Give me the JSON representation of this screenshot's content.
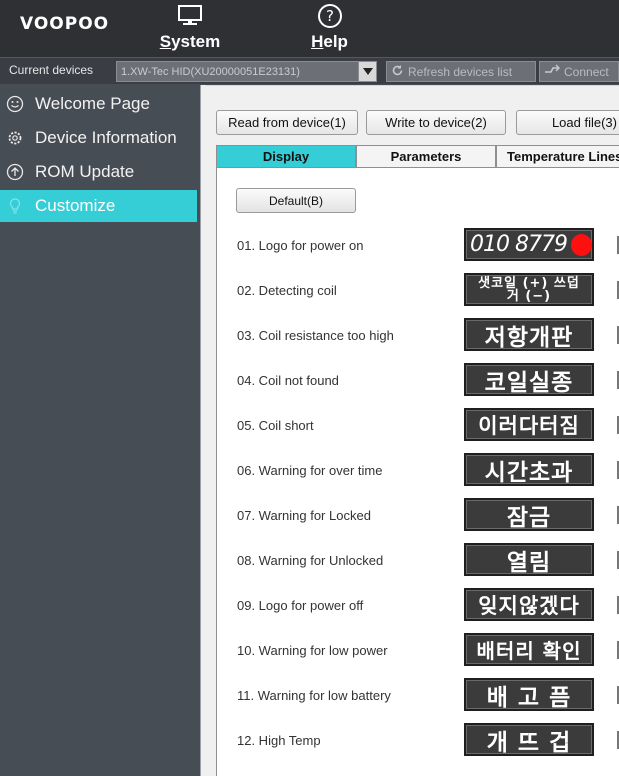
{
  "header": {
    "logo": "VOOPOO",
    "menu": [
      {
        "label": "System",
        "icon": "monitor-icon"
      },
      {
        "label": "Help",
        "icon": "question-circle-icon"
      }
    ]
  },
  "device_bar": {
    "label": "Current devices",
    "selected_device": "1.XW-Tec HID(XU20000051E23131)",
    "refresh_label": "Refresh devices list",
    "connect_label": "Connect"
  },
  "sidebar": {
    "items": [
      {
        "label": "Welcome Page",
        "icon": "smiley-icon",
        "active": false
      },
      {
        "label": "Device Information",
        "icon": "gear-icon",
        "active": false
      },
      {
        "label": "ROM Update",
        "icon": "upload-icon",
        "active": false
      },
      {
        "label": "Customize",
        "icon": "lightbulb-icon",
        "active": true
      }
    ]
  },
  "toolbar": {
    "read_label": "Read from device(1)",
    "write_label": "Write to device(2)",
    "load_label": "Load file(3)"
  },
  "tabs": [
    {
      "label": "Display",
      "active": true
    },
    {
      "label": "Parameters",
      "active": false
    },
    {
      "label": "Temperature Lines",
      "active": false
    }
  ],
  "display": {
    "default_label": "Default(B)",
    "rows": [
      {
        "label": "01. Logo for power on",
        "image_text": "010 8779"
      },
      {
        "label": "02. Detecting coil",
        "image_text": "샛코일 (+) 쓰덥거 (−)"
      },
      {
        "label": "03. Coil resistance too high",
        "image_text": "저항개판"
      },
      {
        "label": "04. Coil not found",
        "image_text": "코일실종"
      },
      {
        "label": "05. Coil short",
        "image_text": "이러다터짐"
      },
      {
        "label": "06. Warning for over time",
        "image_text": "시간초과"
      },
      {
        "label": "07. Warning for Locked",
        "image_text": "잠금"
      },
      {
        "label": "08. Warning for Unlocked",
        "image_text": "열림"
      },
      {
        "label": "09. Logo for power off",
        "image_text": "잊지않겠다"
      },
      {
        "label": "10. Warning for low power",
        "image_text": "배터리 확인"
      },
      {
        "label": "11. Warning for low battery",
        "image_text": "배 고 픔"
      },
      {
        "label": "12. High Temp",
        "image_text": "개 뜨 겁"
      }
    ]
  },
  "colors": {
    "accent": "#35cdd6",
    "sidebar_bg": "#474d55",
    "topbar_bg": "#2e3034"
  }
}
